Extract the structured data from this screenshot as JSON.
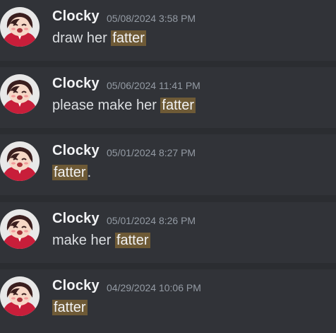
{
  "colors": {
    "background": "#2b2d31",
    "message_bg": "#313338",
    "username": "#f2f3f5",
    "timestamp": "#949ba4",
    "text": "#dbdee1",
    "highlight": "#6e5a36"
  },
  "messages": [
    {
      "author": "Clocky",
      "timestamp": "05/08/2024 3:58 PM",
      "before": "draw her ",
      "highlight": "fatter",
      "after": ""
    },
    {
      "author": "Clocky",
      "timestamp": "05/06/2024 11:41 PM",
      "before": "please make her ",
      "highlight": "fatter",
      "after": ""
    },
    {
      "author": "Clocky",
      "timestamp": "05/01/2024 8:27 PM",
      "before": "",
      "highlight": "fatter",
      "after": "."
    },
    {
      "author": "Clocky",
      "timestamp": "05/01/2024 8:26 PM",
      "before": "make her ",
      "highlight": "fatter",
      "after": ""
    },
    {
      "author": "Clocky",
      "timestamp": "04/29/2024 10:06 PM",
      "before": "",
      "highlight": "fatter",
      "after": ""
    }
  ]
}
